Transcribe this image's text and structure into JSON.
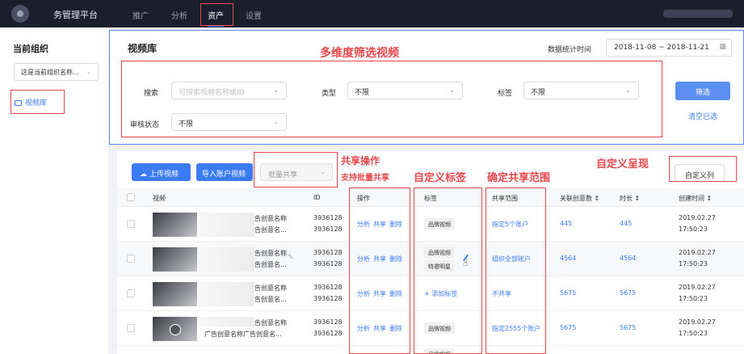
{
  "topnav": {
    "brand": "务管理平台",
    "items": [
      {
        "label": "推广",
        "active": false
      },
      {
        "label": "分析",
        "active": false
      },
      {
        "label": "资产",
        "active": true
      },
      {
        "label": "设置",
        "active": false
      }
    ]
  },
  "sidebar": {
    "title": "当前组织",
    "org_select": "这是当前组织名称...",
    "items": [
      {
        "label": "视频库",
        "icon": "video-library-icon",
        "active": true
      }
    ]
  },
  "filter_panel": {
    "title": "视频库",
    "date_label": "数据统计时间",
    "date_range": "2018-11-08 ~ 2018-11-21",
    "fields": {
      "search_label": "搜索",
      "search_placeholder": "可搜索视频名称或ID",
      "type_label": "类型",
      "type_value": "不限",
      "tag_label": "标签",
      "tag_value": "不限",
      "status_label": "审核状态",
      "status_value": "不限"
    },
    "filter_button": "筛选",
    "clear_link": "清空已选"
  },
  "toolbar": {
    "upload_button": "上传视频",
    "import_button": "导入账户视频",
    "bulk_share": "批量共享",
    "custom_columns": "自定义列"
  },
  "table": {
    "columns": [
      "视频",
      "ID",
      "操作",
      "标签",
      "共享范围",
      "关联创意数",
      "时长",
      "创建时间"
    ],
    "actions": [
      "分析",
      "共享",
      "删除"
    ],
    "rows": [
      {
        "name1": "告创意名称",
        "name2": "告创意名...",
        "id1": "3936128",
        "id2": "3936128",
        "tags": [
          "品牌视频"
        ],
        "scope": "指定5个账户",
        "creatives": "445",
        "duration": "445",
        "date": "2019.02.27",
        "time": "17:50:23"
      },
      {
        "name1": "告创意名称",
        "name2": "告创意名...",
        "id1": "3936128",
        "id2": "3936128",
        "tags": [
          "品牌视频",
          "特邀明星"
        ],
        "scope": "组织全部账户",
        "creatives": "4564",
        "duration": "4564",
        "date": "2019.02.27",
        "time": "17:50:23"
      },
      {
        "name1": "告创意名称",
        "name2": "告创意名...",
        "id1": "3936128",
        "id2": "3936128",
        "tags": [],
        "add_tag": "+ 添加标签",
        "scope": "不共享",
        "creatives": "5675",
        "duration": "5675",
        "date": "2019.02.27",
        "time": "17:50:23"
      },
      {
        "name1": "告创意名称",
        "name2": "广告创意名称广告创意名...",
        "id1": "3936128",
        "id2": "3936128",
        "tags": [
          "品牌视频"
        ],
        "scope": "指定2555个账户",
        "creatives": "5675",
        "duration": "5675",
        "date": "2019.02.27",
        "time": "17:50:23"
      }
    ],
    "partial_tag": "品牌视频"
  },
  "annotations": {
    "multi_filter": "多维度筛选视频",
    "share_op_1": "共享操作",
    "share_op_2": "支持批量共享",
    "custom_tag": "自定义标签",
    "share_scope": "确定共享范围",
    "custom_view": "自定义呈现"
  },
  "colors": {
    "accent": "#3b7cf6",
    "annotation": "#e5484d",
    "nav_bg": "#1b1f2d"
  }
}
